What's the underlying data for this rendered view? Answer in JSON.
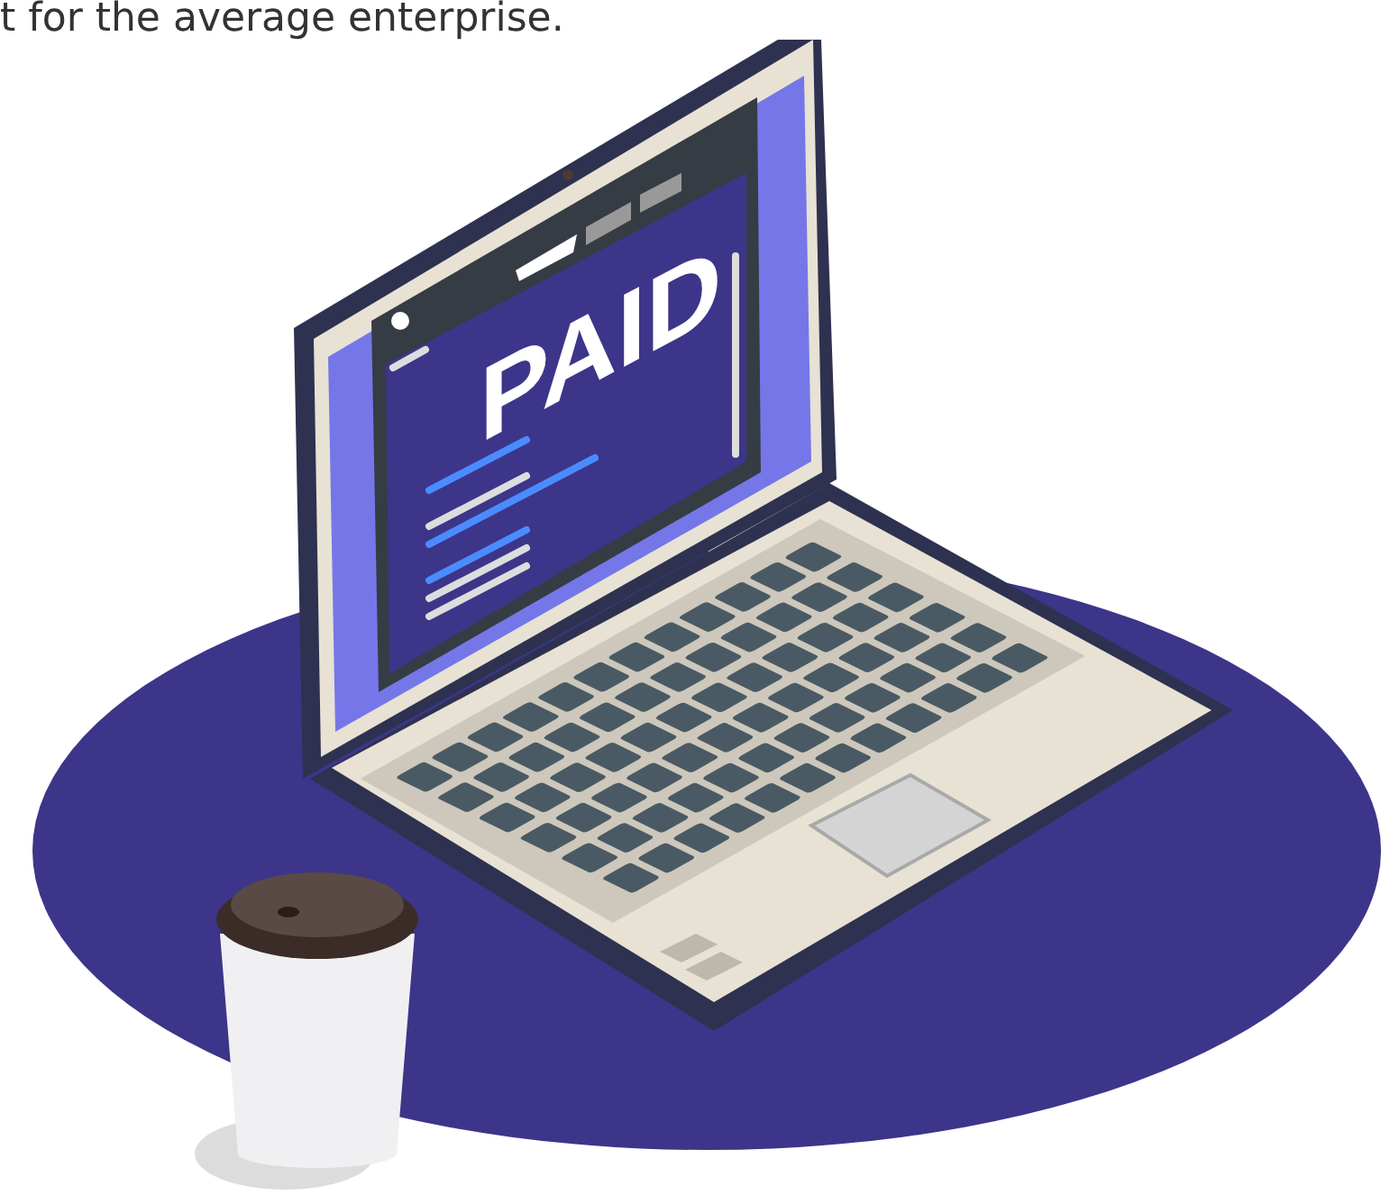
{
  "caption": "t for the average enterprise.",
  "illustration": {
    "screen_text": "PAID"
  }
}
